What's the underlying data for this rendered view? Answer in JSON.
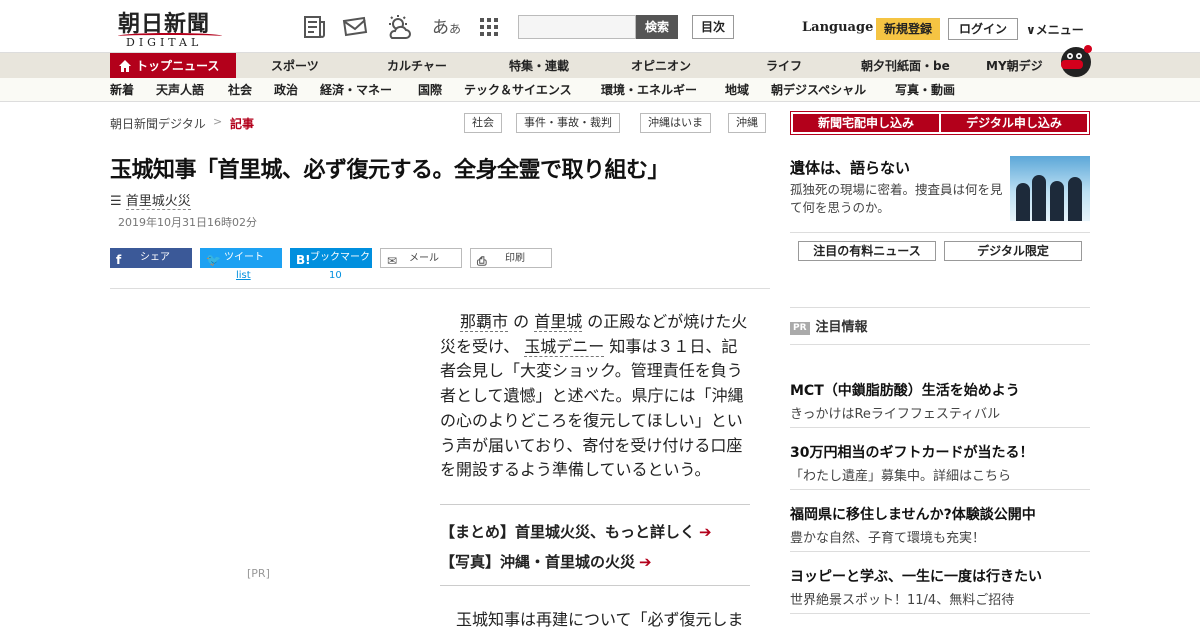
{
  "header": {
    "logo_text": "朝日新聞",
    "logo_sub": "DIGITAL",
    "font_toggle_large": "あ",
    "font_toggle_small": "あ",
    "search_button": "検索",
    "index_button": "目次",
    "language": "Language",
    "register": "新規登録",
    "login": "ログイン",
    "menu": "メニュー"
  },
  "nav_primary": [
    "トップニュース",
    "スポーツ",
    "カルチャー",
    "特集・連載",
    "オピニオン",
    "ライフ",
    "朝夕刊紙面・be",
    "MY朝デジ"
  ],
  "nav_secondary": [
    "新着",
    "天声人語",
    "社会",
    "政治",
    "経済・マネー",
    "国際",
    "テック＆サイエンス",
    "環境・エネルギー",
    "地域",
    "朝デジスペシャル",
    "写真・動画"
  ],
  "breadcrumb": {
    "home": "朝日新聞デジタル",
    "separator": ">",
    "current": "記事"
  },
  "tags": [
    "社会",
    "事件・事故・裁判",
    "沖縄はいま",
    "沖縄"
  ],
  "subscribe": {
    "paper": "新聞宅配申し込み",
    "digital": "デジタル申し込み"
  },
  "article": {
    "title": "玉城知事「首里城、必ず復元する。全身全霊で取り組む」",
    "topic": "首里城火災",
    "date": "2019年10月31日16時02分",
    "share": {
      "facebook": "シェア",
      "twitter": "ツイート",
      "hatena": "ブックマーク",
      "mail": "メール",
      "print": "印刷"
    },
    "counts": {
      "twitter": "list",
      "hatena": "10"
    },
    "pr_label": "[PR]",
    "body": {
      "kw1": "那覇市",
      "t1": " の ",
      "kw2": "首里城",
      "t2": " の正殿などが焼けた火災を受け、 ",
      "kw3": "玉城デニー",
      "t3": " 知事は３１日、記者会見し「大変ショック。管理責任を負う者として遺憾」と述べた。県庁には「沖縄の心のよりどころを復元してほしい」という声が届いており、寄付を受け付ける口座を開設するよう準備しているという。"
    },
    "related": [
      "【まとめ】首里城火災、もっと詳しく",
      "【写真】沖縄・首里城の火災"
    ],
    "body2": "玉城知事は再建について「必ず復元しま"
  },
  "sidebar": {
    "promo_title": "遺体は、語らない",
    "promo_desc": "孤独死の現場に密着。捜査員は何を見て何を思うのか。",
    "buttons": [
      "注目の有料ニュース",
      "デジタル限定"
    ],
    "pr_badge": "PR",
    "pr_heading": "注目情報",
    "ads": [
      {
        "title": "MCT（中鎖脂肪酸）生活を始めよう",
        "desc": "きっかけはReライフフェスティバル"
      },
      {
        "title": "30万円相当のギフトカードが当たる！",
        "desc": "「わたし遺産」募集中。詳細はこちら"
      },
      {
        "title": "福岡県に移住しませんか?体験談公開中",
        "desc": "豊かな自然、子育て環境も充実！"
      },
      {
        "title": "ヨッピーと学ぶ、一生に一度は行きたい",
        "desc": "世界絶景スポット！11/4、無料ご招待"
      }
    ]
  },
  "colors": {
    "brand_red": "#b3001b",
    "register_yellow": "#f5c443",
    "facebook": "#3b5998",
    "twitter": "#1da1f2",
    "hatena": "#008fde"
  }
}
